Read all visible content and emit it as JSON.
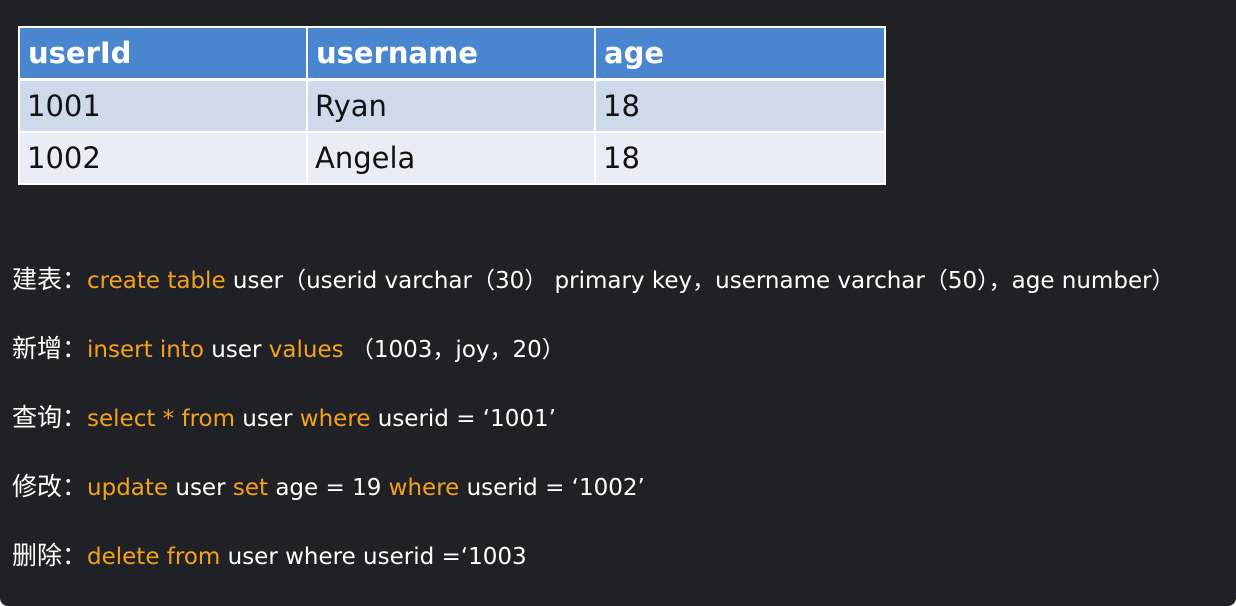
{
  "table": {
    "headers": [
      "userId",
      "username",
      "age"
    ],
    "rows": [
      [
        "1001",
        "Ryan",
        "18"
      ],
      [
        "1002",
        "Angela",
        "18"
      ]
    ]
  },
  "sql": {
    "create": {
      "label": "建表：",
      "kw1": "create table",
      "t1": " user（userid varchar（30） primary key，username varchar（50），age number）"
    },
    "insert": {
      "label": "新增：",
      "kw1": "insert into",
      "t1": " user ",
      "kw2": "values",
      "t2": " （1003，joy，20）"
    },
    "select": {
      "label": "查询：",
      "kw1": "select * from",
      "t1": " user ",
      "kw2": "where",
      "t2": " userid = ‘1001’"
    },
    "update": {
      "label": "修改：",
      "kw1": "update",
      "t1": " user ",
      "kw2": "set",
      "t2": " age = 19 ",
      "kw3": "where",
      "t3": " userid = ‘1002’"
    },
    "delete": {
      "label": "删除：",
      "kw1": "delete from",
      "t1": " user where userid =‘1003"
    }
  },
  "colors": {
    "background": "#202126",
    "header": "#4a86cf",
    "row_odd": "#cfd9ec",
    "row_even": "#e8edf6",
    "keyword": "#f4a21c"
  }
}
